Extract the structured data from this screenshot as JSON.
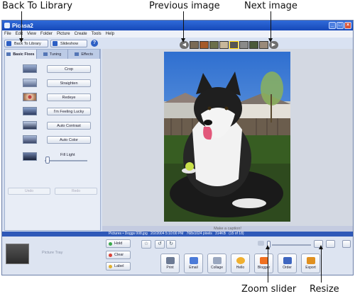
{
  "callouts": {
    "back_to_library": "Back To Library",
    "previous_image": "Previous image",
    "next_image": "Next image",
    "zoom_slider": "Zoom slider",
    "resize": "Resize"
  },
  "window": {
    "title": "Picasa2"
  },
  "menu": [
    "File",
    "Edit",
    "View",
    "Folder",
    "Picture",
    "Create",
    "Tools",
    "Help"
  ],
  "toolbar": {
    "back_label": "Back To Library",
    "slideshow_label": "Slideshow",
    "help_label": "?"
  },
  "tabs": {
    "basic": "Basic Fixes",
    "tuning": "Tuning",
    "effects": "Effects"
  },
  "fixes": {
    "crop": "Crop",
    "straighten": "Straighten",
    "redeye": "Redeye",
    "lucky": "I'm Feeling Lucky",
    "contrast": "Auto Contrast",
    "color": "Auto Color",
    "fill_light": "Fill Light",
    "fill_light_level": 0.05,
    "undo": "Undo",
    "redo": "Redo"
  },
  "viewer": {
    "caption_placeholder": "Make a caption!"
  },
  "pathbar": {
    "path": "Pictures • Doggs 008.jpg",
    "date": "2/2/2004 5:10:00 PM",
    "dims": "768x1024 pixels",
    "size": "314KB",
    "index": "(15 of 18)"
  },
  "tray": {
    "label": "Picture Tray",
    "hold": "Hold",
    "clear": "Clear",
    "label_btn": "Label"
  },
  "actions": {
    "print": "Print",
    "email": "Email",
    "collage": "Collage",
    "hello": "Hello",
    "blogger": "Blogger",
    "order": "Order",
    "export": "Export"
  },
  "colors": {
    "title_bar": "#1f55c8",
    "path_bar": "#2f59b8",
    "panel_bg": "#e8edf6"
  }
}
